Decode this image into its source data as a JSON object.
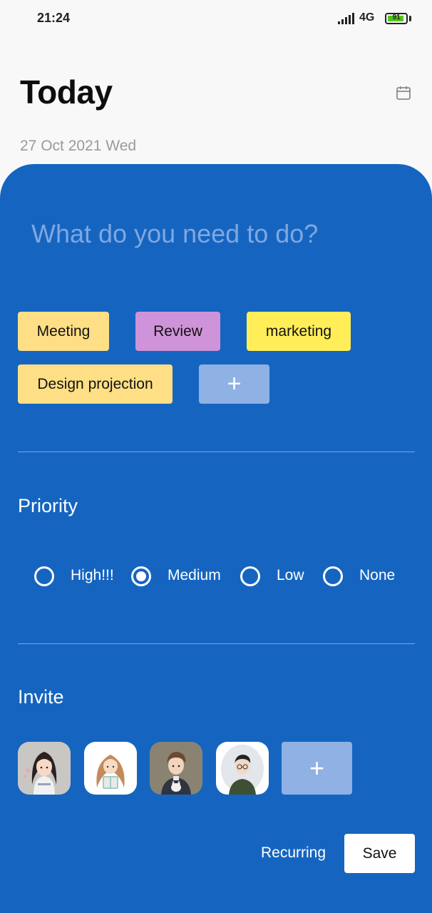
{
  "status_bar": {
    "time": "21:24",
    "network": "4G",
    "battery": "91",
    "battery_level": 0.91,
    "signal_icon": "signal-bars-icon",
    "battery_icon": "battery-icon"
  },
  "header": {
    "title": "Today",
    "date": "27 Oct 2021 Wed",
    "calendar_icon": "calendar-icon"
  },
  "task": {
    "placeholder": "What do you need to do?",
    "value": ""
  },
  "tags": {
    "items": [
      {
        "label": "Meeting",
        "color": "#ffdf85"
      },
      {
        "label": "Review",
        "color": "#cf93d9"
      },
      {
        "label": "marketing",
        "color": "#ffee58"
      },
      {
        "label": "Design projection",
        "color": "#ffdf85"
      }
    ],
    "add_label": "+"
  },
  "priority": {
    "label": "Priority",
    "options": [
      "High!!!",
      "Medium",
      "Low",
      "None"
    ],
    "selected": "Medium"
  },
  "invite": {
    "label": "Invite",
    "avatars": [
      "avatar-girl-long-hair",
      "avatar-girl-reading",
      "avatar-boy-with-cat",
      "avatar-boy-glasses"
    ],
    "add_label": "+"
  },
  "actions": {
    "recurring_label": "Recurring",
    "save_label": "Save"
  },
  "colors": {
    "panel": "#1565c0",
    "add_button": "#8fb1e4",
    "placeholder": "#7fa7e0"
  }
}
